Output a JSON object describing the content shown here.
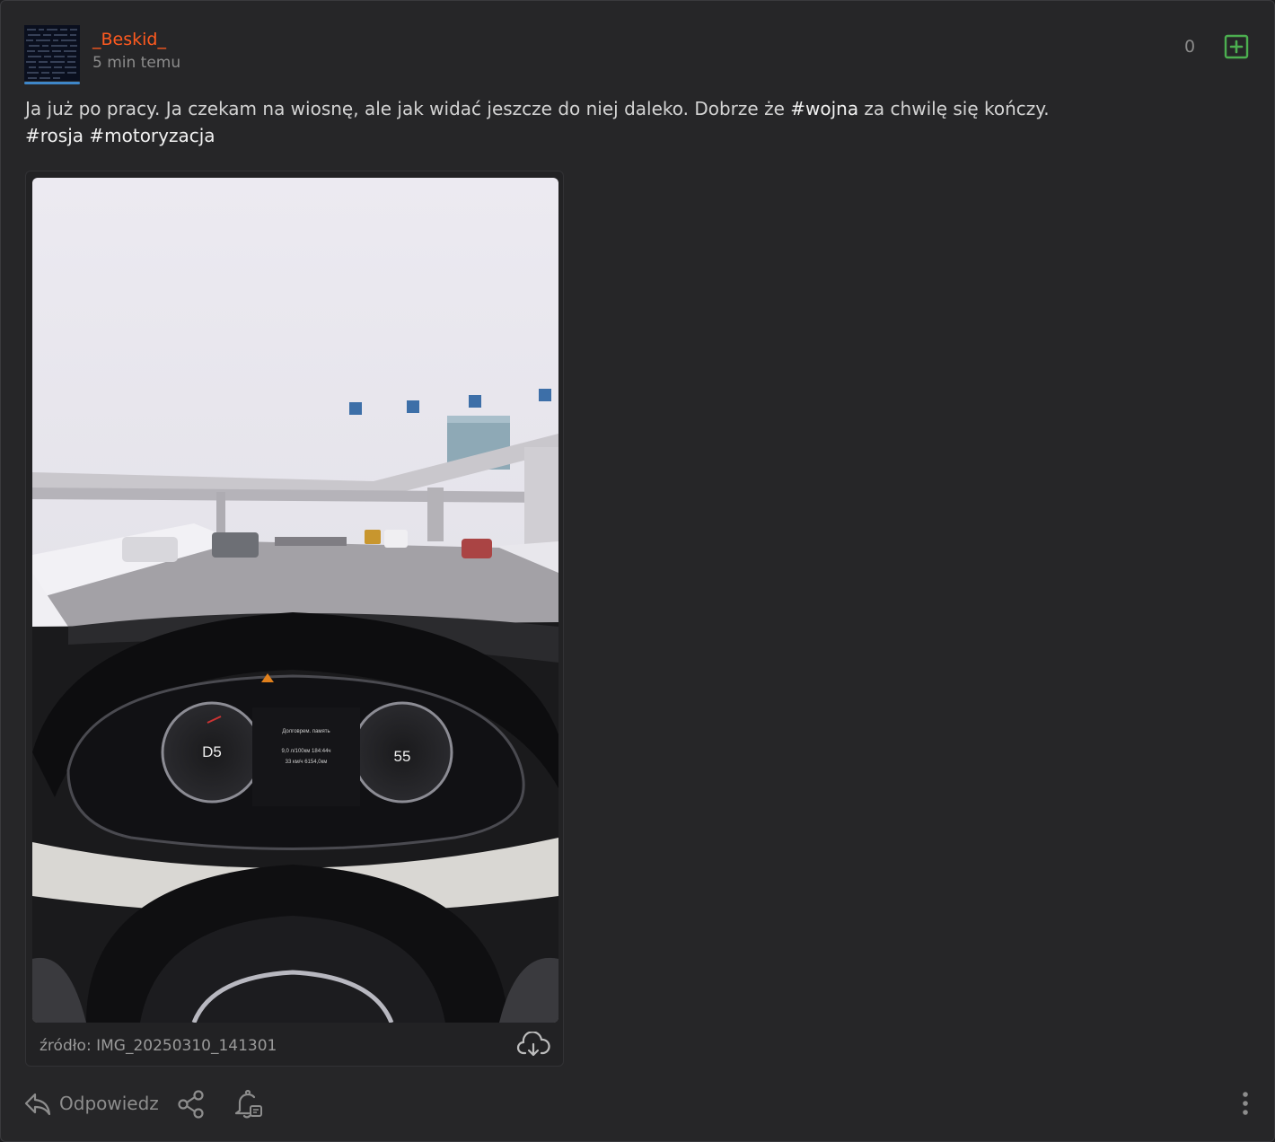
{
  "post": {
    "username": "_Beskid_",
    "timestamp": "5 min temu",
    "votes": "0",
    "text_before": "Ja już po pracy. Ja czekam na wiosnę, ale jak widać jeszcze do niej daleko. Dobrze że ",
    "tag_wojna": "#wojna",
    "text_after": " za chwilę się kończy.",
    "tag_rosja": "#rosja",
    "tag_motoryzacja": "#motoryzacja"
  },
  "media": {
    "source": "źródło: IMG_20250310_141301"
  },
  "actions": {
    "reply_label": "Odpowiedz"
  },
  "colors": {
    "username": "#ff5a1f",
    "plus_accent": "#4caf50",
    "avatar_underline": "#3f87c9"
  },
  "icons": [
    "avatar",
    "plus-square-icon",
    "cloud-download-icon",
    "reply-icon",
    "share-icon",
    "bell-icon",
    "more-vertical-icon"
  ]
}
